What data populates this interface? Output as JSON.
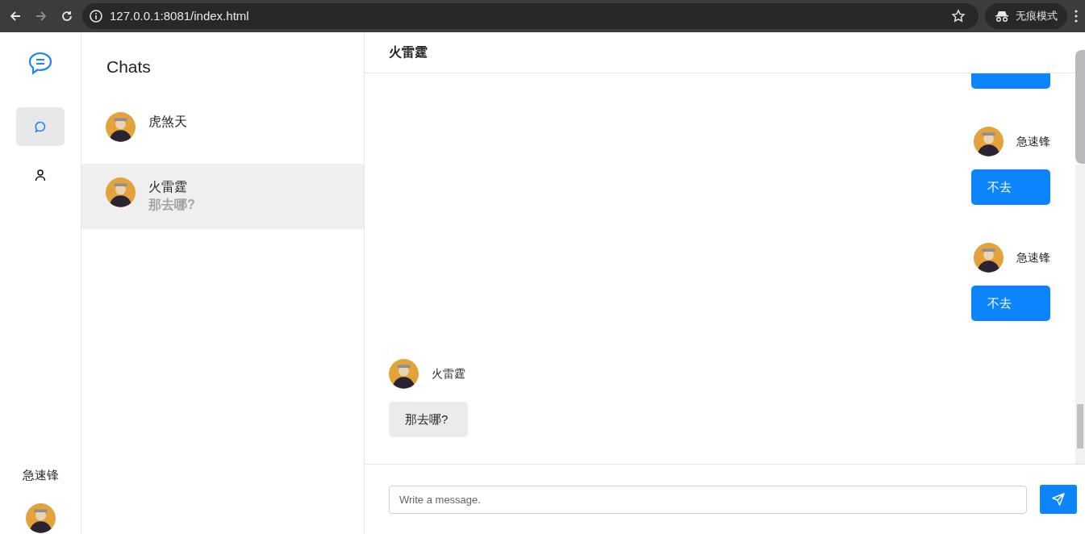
{
  "browser": {
    "url": "127.0.0.1:8081/index.html",
    "incognito_label": "无痕模式"
  },
  "rail": {
    "nav": [
      {
        "kind": "chat",
        "selected": true
      },
      {
        "kind": "contacts",
        "selected": false
      }
    ],
    "user_name": "急速锋"
  },
  "chat_list": {
    "title": "Chats",
    "chats": [
      {
        "name": "虎煞天",
        "selected": false
      },
      {
        "name": "火雷霆",
        "preview": "那去哪?",
        "selected": true
      }
    ]
  },
  "conversation": {
    "title": "火雷霆",
    "messages": [
      {
        "kind": "outgoing",
        "partial": true
      },
      {
        "kind": "outgoing",
        "sender": "急速锋",
        "text": "不去"
      },
      {
        "kind": "outgoing",
        "sender": "急速锋",
        "text": "不去"
      },
      {
        "kind": "incoming",
        "sender": "火雷霆",
        "text": "那去哪?"
      }
    ]
  },
  "composer": {
    "placeholder": "Write a message."
  }
}
